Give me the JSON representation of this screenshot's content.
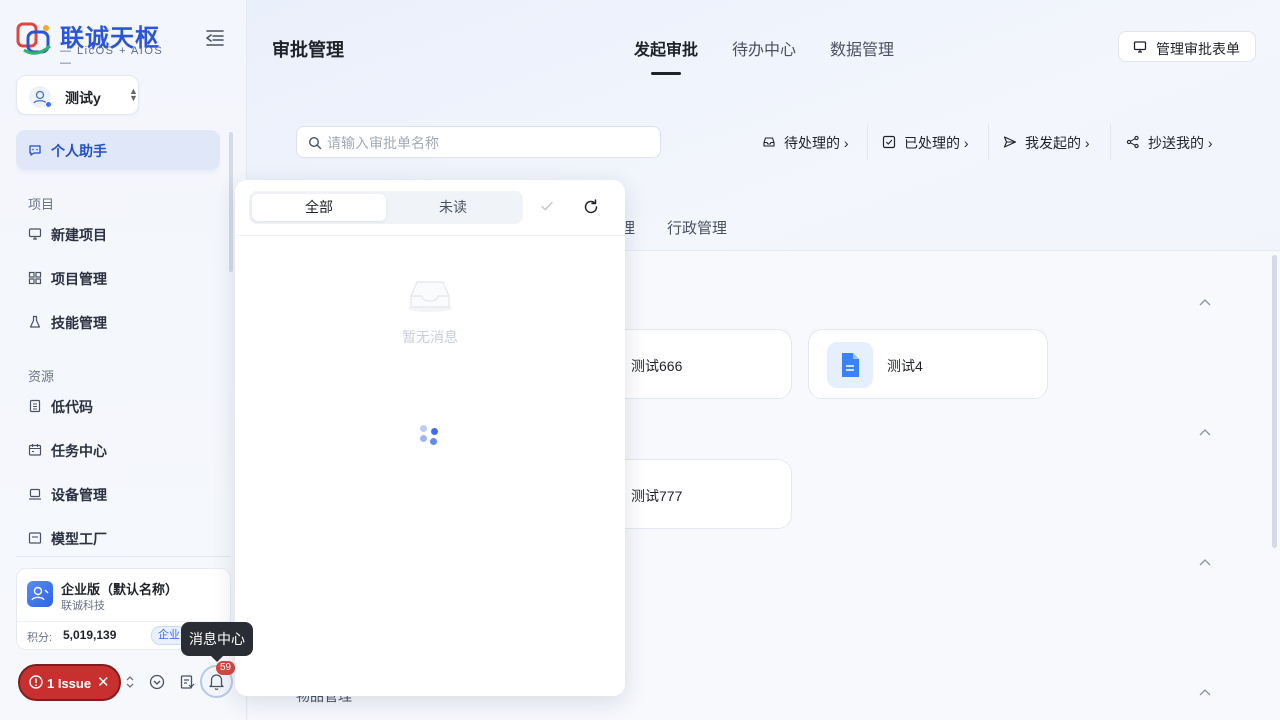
{
  "sidebar": {
    "logo": {
      "title": "联诚天枢",
      "subtitle": "— LicOS + AIOS —"
    },
    "user": {
      "name": "测试y"
    },
    "nav": {
      "assistant": "个人助手",
      "group_project": "项目",
      "new_project": "新建项目",
      "project_mgmt": "项目管理",
      "skill_mgmt": "技能管理",
      "group_resource": "资源",
      "low_code": "低代码",
      "task_center": "任务中心",
      "device_mgmt": "设备管理",
      "model_factory": "模型工厂"
    },
    "enterprise": {
      "name": "企业版（默认名称）",
      "org": "联诚科技",
      "points_label": "积分:",
      "points_value": "5,019,139",
      "tag": "企业"
    },
    "issue": {
      "label": "1 Issue"
    },
    "bell_badge": "59",
    "tooltip": "消息中心"
  },
  "header": {
    "title": "审批管理",
    "tabs": [
      "发起审批",
      "待办中心",
      "数据管理"
    ],
    "manage_button": "管理审批表单"
  },
  "search": {
    "placeholder": "请输入审批单名称",
    "value": ""
  },
  "quick_links": [
    "待处理的",
    "已处理的",
    "我发起的",
    "抄送我的"
  ],
  "category_tabs": [
    "理",
    "行政管理"
  ],
  "cards": [
    "测试666",
    "测试4",
    "测试777"
  ],
  "partial_label": "物品管理",
  "notification_panel": {
    "tabs": [
      "全部",
      "未读"
    ],
    "empty_text": "暂无消息"
  },
  "colors": {
    "accent": "#3b6ef6",
    "issue": "#c8302f",
    "brand": "#2a55d9"
  }
}
